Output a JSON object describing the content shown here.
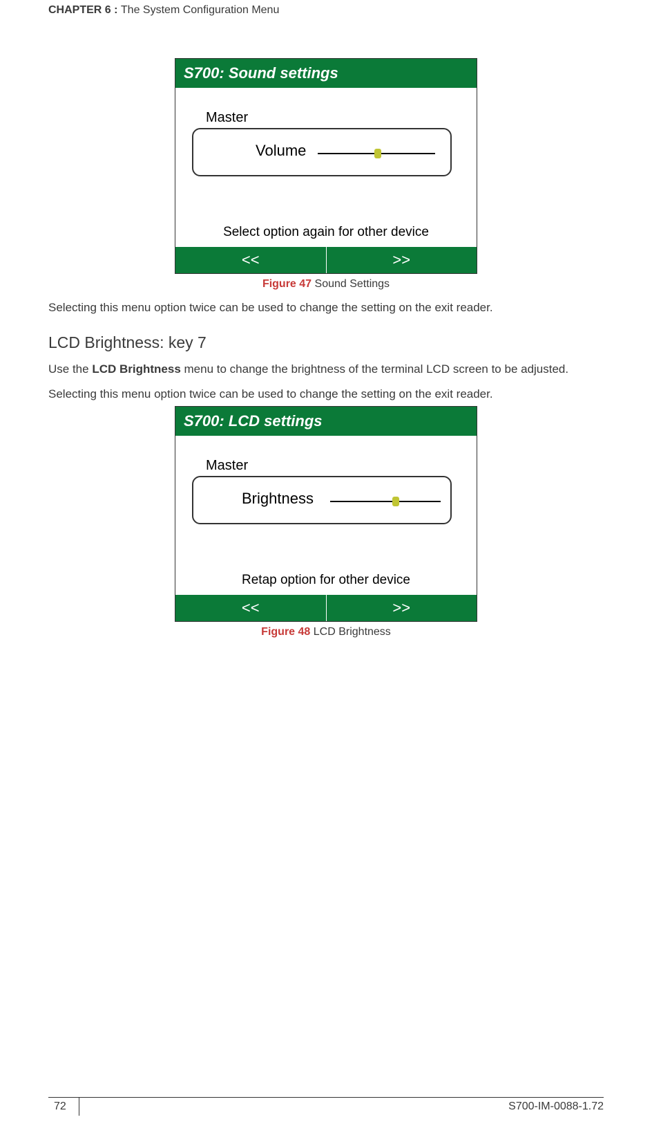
{
  "header": {
    "chapterLabel": "CHAPTER  6 : ",
    "chapterTitle": "The System Configuration Menu"
  },
  "figure47": {
    "title": "S700: Sound settings",
    "groupLabel": "Master",
    "sliderLabel": "Volume",
    "hint": "Select option again for other device",
    "prev": "<<",
    "next": ">>",
    "captionStrong": "Figure 47",
    "captionRest": " Sound Settings"
  },
  "para1": "Selecting this menu option twice can be used to change the setting on the exit reader.",
  "section2": {
    "heading": "LCD Brightness: key 7",
    "para_a": "Use the ",
    "para_bold": "LCD Brightness",
    "para_b": " menu to change the brightness of the terminal LCD screen to be adjusted.",
    "para2": "Selecting this menu option twice can be used to change the setting on the exit reader."
  },
  "figure48": {
    "title": "S700: LCD settings",
    "groupLabel": "Master",
    "sliderLabel": "Brightness",
    "hint": "Retap option for other device",
    "prev": "<<",
    "next": ">>",
    "captionStrong": "Figure 48",
    "captionRest": " LCD Brightness"
  },
  "footer": {
    "pageNumber": "72",
    "docId": "S700-IM-0088-1.72"
  }
}
